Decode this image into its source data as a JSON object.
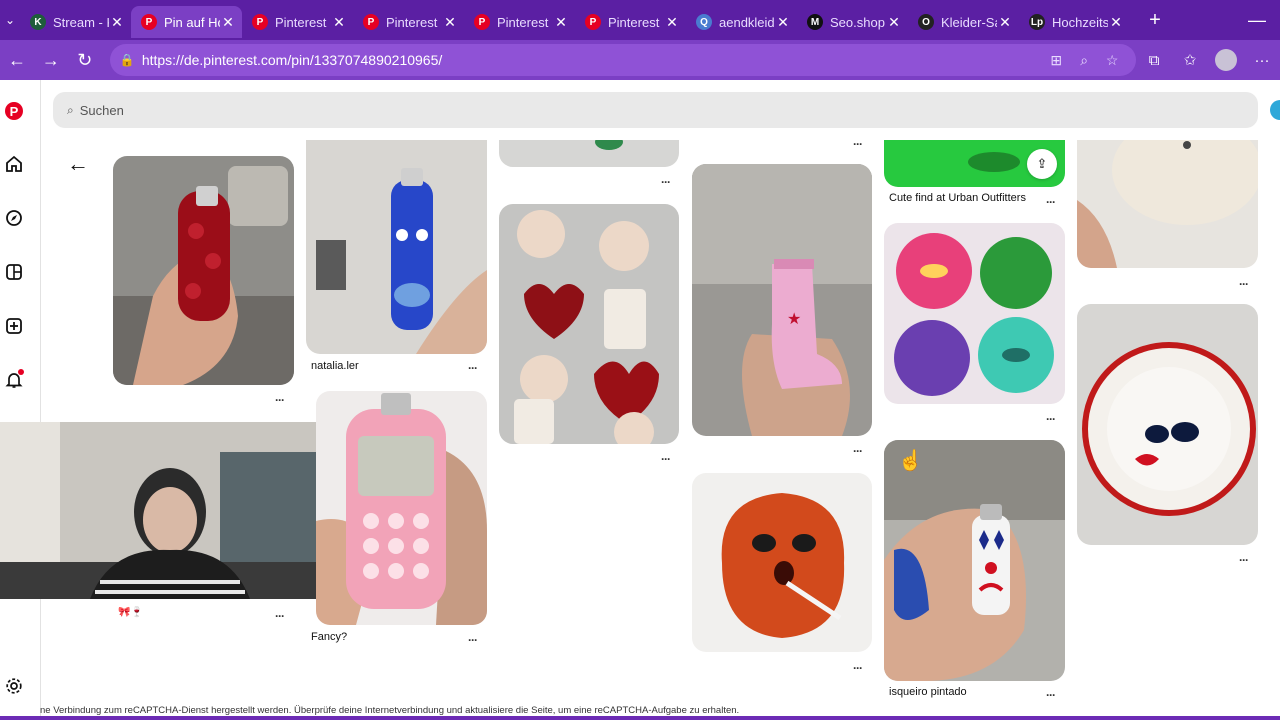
{
  "browser": {
    "tabs": [
      {
        "title": "Stream - K",
        "fav": "K",
        "fav_color": "#1f5d3b",
        "active": false
      },
      {
        "title": "Pin auf Ho",
        "fav": "P",
        "fav_color": "#e60023",
        "active": true
      },
      {
        "title": "Pinterest",
        "fav": "P",
        "fav_color": "#e60023",
        "active": false
      },
      {
        "title": "Pinterest",
        "fav": "P",
        "fav_color": "#e60023",
        "active": false
      },
      {
        "title": "Pinterest",
        "fav": "P",
        "fav_color": "#e60023",
        "active": false
      },
      {
        "title": "Pinterest",
        "fav": "P",
        "fav_color": "#e60023",
        "active": false
      },
      {
        "title": "aendkleid",
        "fav": "Q",
        "fav_color": "#4a7bd0",
        "active": false
      },
      {
        "title": "Seo.shop.",
        "fav": "M",
        "fav_color": "#111111",
        "active": false
      },
      {
        "title": "Kleider-Sa",
        "fav": "O",
        "fav_color": "#222222",
        "active": false
      },
      {
        "title": "Hochzeits",
        "fav": "Lp",
        "fav_color": "#222222",
        "active": false
      }
    ],
    "url": "https://de.pinterest.com/pin/1337074890210965/"
  },
  "search": {
    "placeholder": "Suchen"
  },
  "pins": {
    "p2": {
      "title": "natalia.ler"
    },
    "p3": {
      "title": "Fancy?"
    },
    "p7": {
      "title": "Cute find at Urban Outfitters"
    },
    "p9": {
      "title": "isqueiro pintado"
    },
    "p1_caption": "🎀🍷"
  },
  "footer": {
    "recaptcha": "ne Verbindung zum reCAPTCHA-Dienst hergestellt werden. Überprüfe deine Internetverbindung und aktualisiere die Seite, um eine reCAPTCHA-Aufgabe zu erhalten."
  },
  "colors": {
    "browser_tab_bg": "#5b1fa3",
    "browser_addr_bg": "#7b3fc4",
    "pinterest_red": "#e60023"
  }
}
